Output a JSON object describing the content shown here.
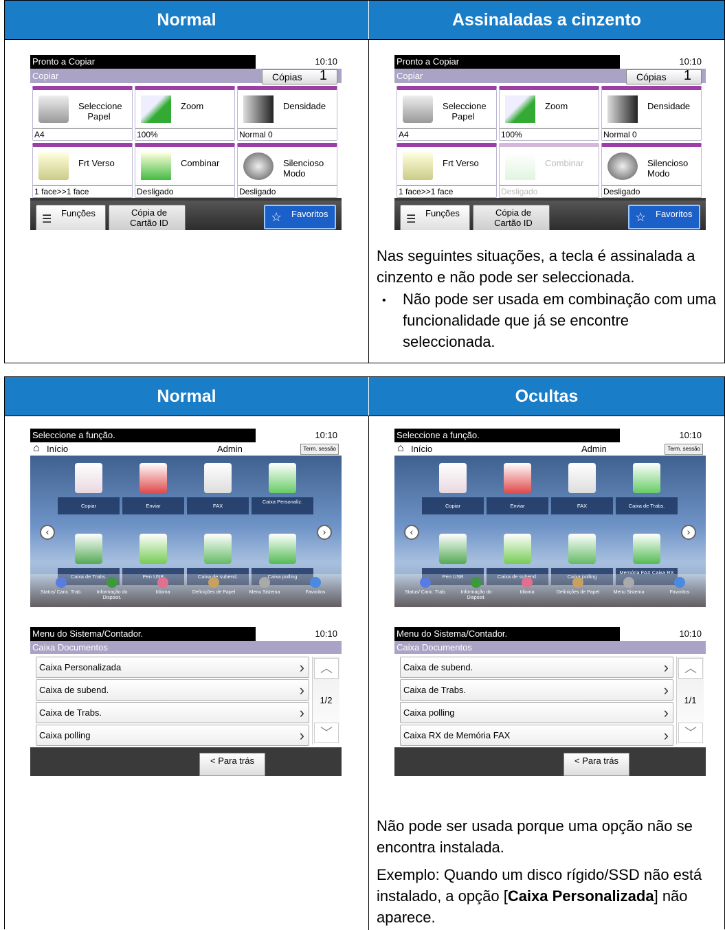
{
  "table1": {
    "h_left": "Normal",
    "h_right": "Assinaladas a cinzento",
    "text1": "Nas seguintes situações, a tecla é assinalada a cinzento e não pode ser seleccionada.",
    "bullet": "Não pode ser usada em combinação com uma funcionalidade que já se encontre seleccionada."
  },
  "table2": {
    "h_left": "Normal",
    "h_right": "Ocultas",
    "text1": "Não pode ser usada porque uma opção não se encontra instalada.",
    "text2a": "Exemplo: Quando um disco rígido/SSD não está instalado, a opção [",
    "text2b": "Caixa Personalizada",
    "text2c": "] não aparece."
  },
  "copy": {
    "status": "Pronto a Copiar",
    "time": "10:10",
    "sub": "Copiar",
    "copies_label": "Cópias",
    "copies": "1",
    "tiles": [
      {
        "label": "Seleccione Papel",
        "value": "A4"
      },
      {
        "label": "Zoom",
        "value": "100%"
      },
      {
        "label": "Densidade",
        "value": "Normal 0"
      },
      {
        "label": "Frt Verso",
        "value": "1 face>>1 face"
      },
      {
        "label": "Combinar",
        "value": "Desligado"
      },
      {
        "label": "Silencioso Modo",
        "value": "Desligado"
      }
    ],
    "btn_funcs": "Funções",
    "btn_card": "Cópia de Cartão ID",
    "btn_fav": "Favoritos"
  },
  "home": {
    "status": "Seleccione a função.",
    "time": "10:10",
    "home_label": "Início",
    "admin": "Admin",
    "logout": "Term. sessão",
    "apps_normal": [
      "Copiar",
      "Enviar",
      "FAX",
      "Caixa Personaliz.",
      "Caixa de Trabs.",
      "Pen USB",
      "Caixa de subend.",
      "Caixa polling"
    ],
    "apps_hidden": [
      "Copiar",
      "Enviar",
      "FAX",
      "Caixa de Trabs.",
      "Pen USB",
      "Caixa de subend.",
      "Caixa polling",
      "Memória FAX Caixa RX"
    ],
    "dock": [
      "Status/ Canc. Trab.",
      "Informação do Disposit.",
      "Idioma",
      "Definições de Papel",
      "Menu Sistema",
      "Favoritos"
    ]
  },
  "menu": {
    "status": "Menu do Sistema/Contador.",
    "time": "10:10",
    "sub": "Caixa Documentos",
    "back": "< Para trás",
    "items_normal": [
      "Caixa Personalizada",
      "Caixa de subend.",
      "Caixa de Trabs.",
      "Caixa polling"
    ],
    "page_normal": "1/2",
    "items_hidden": [
      "Caixa de subend.",
      "Caixa de Trabs.",
      "Caixa polling",
      "Caixa RX de Memória FAX"
    ],
    "page_hidden": "1/1"
  },
  "colors": {
    "header_blue": "#1a7dc8",
    "tile_accent": "#9b3fa6",
    "fav_blue": "#1b5fc9"
  }
}
